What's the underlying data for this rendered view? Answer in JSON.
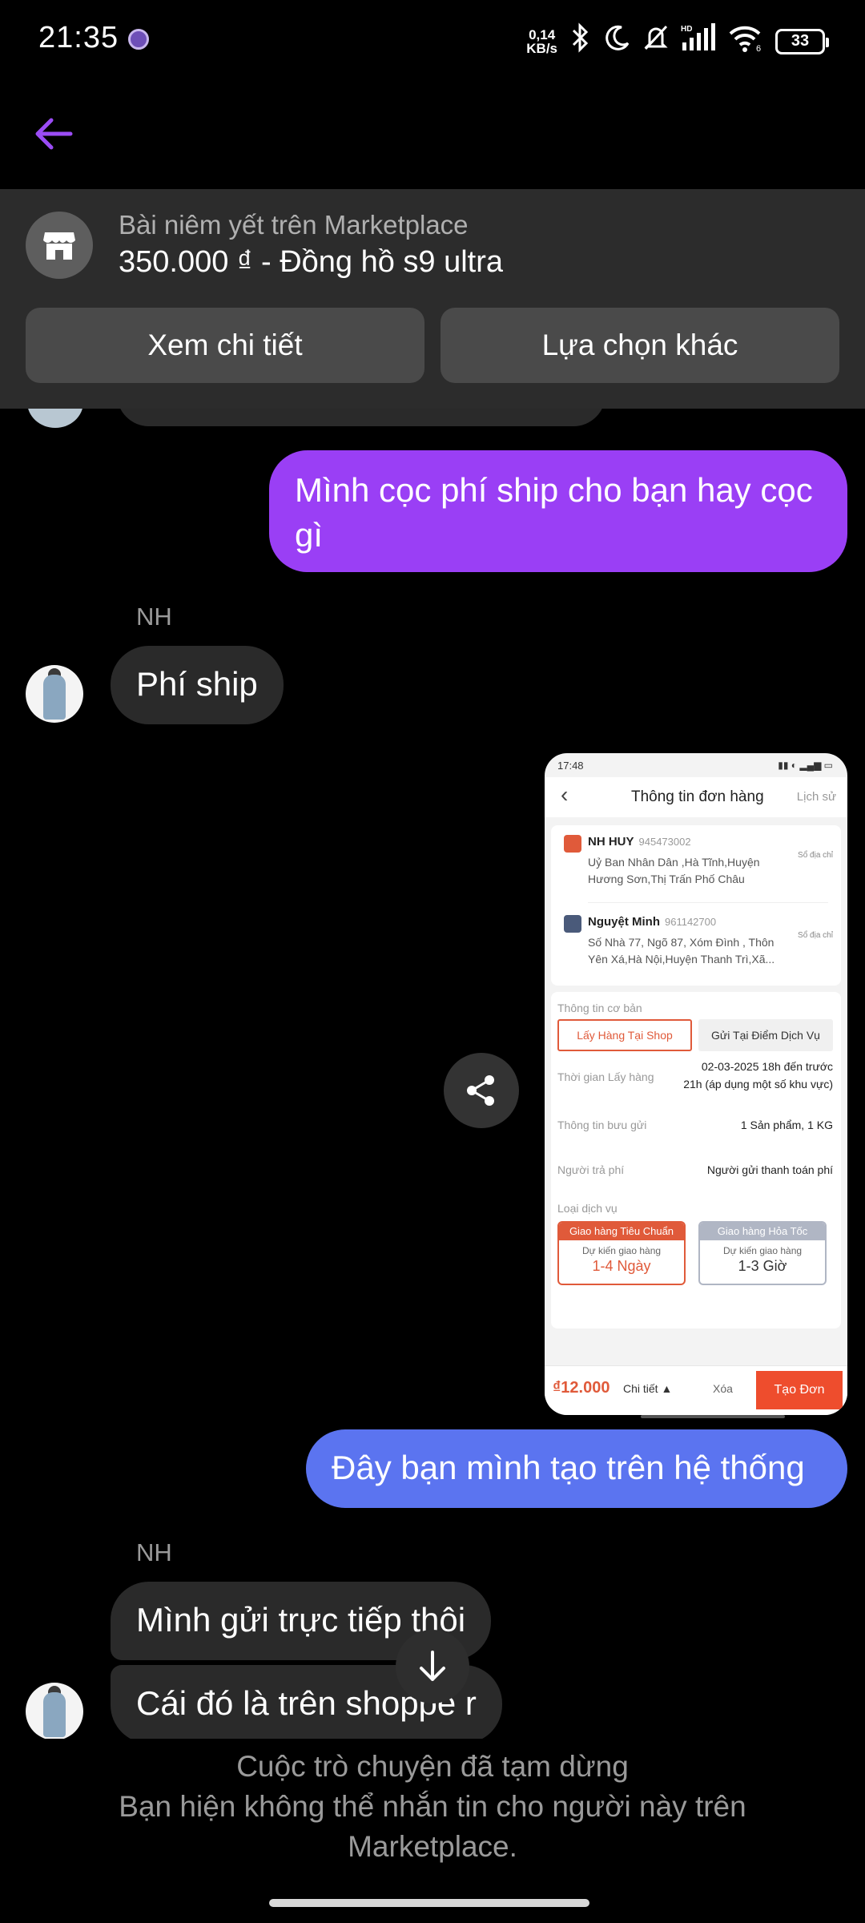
{
  "status_bar": {
    "time": "21:35",
    "net_speed": "0,14",
    "net_unit": "KB/s",
    "icons": [
      "bluetooth-icon",
      "moon-icon",
      "bell-off-icon",
      "signal-hd-icon",
      "wifi-icon"
    ],
    "wifi_badge": "6",
    "battery": "33"
  },
  "header": {
    "back_icon": "arrow-left-icon",
    "accent_color": "#9b4cf5"
  },
  "listing": {
    "icon": "storefront-icon",
    "caption": "Bài niêm yết trên Marketplace",
    "title": "350.000 ₫ - Đồng hồ s9 ultra",
    "buttons": {
      "details": "Xem chi tiết",
      "other": "Lựa chọn khác"
    }
  },
  "messages": {
    "out_1": "Mình cọc phí ship cho bạn hay cọc gì",
    "sender_1": "NH",
    "in_1": "Phí ship",
    "out_2": "Đây bạn mình tạo trên hệ thống",
    "sender_2": "NH",
    "in_2": "Mình gửi trực tiếp thôi",
    "in_3": "Cái đó là trên shoppe r"
  },
  "attachment": {
    "time": "17:48",
    "title": "Thông tin đơn hàng",
    "history": "Lịch sử",
    "sender_name": "NH HUY",
    "sender_phone": "945473002",
    "sender_addr": "Uỷ Ban Nhân Dân ,Hà Tĩnh,Huyện Hương Sơn,Thị Trấn Phố Châu",
    "receiver_name": "Nguyệt Minh",
    "receiver_phone": "961142700",
    "receiver_addr": "Số Nhà 77, Ngõ 87, Xóm Đình , Thôn Yên Xá,Hà Nội,Huyện Thanh Trì,Xã...",
    "addr_book": "Sổ địa chỉ",
    "basic_info": "Thông tin cơ bản",
    "tab_pickup": "Lấy Hàng Tại Shop",
    "tab_dropoff": "Gửi Tại Điểm Dịch Vụ",
    "pickup_time_label": "Thời gian Lấy hàng",
    "pickup_time_value": "02-03-2025 18h đến trước 21h (áp dụng một số khu vực)",
    "parcel_label": "Thông tin bưu gửi",
    "parcel_value": "1 Sản phẩm, 1 KG",
    "payer_label": "Người trả phí",
    "payer_value": "Người gửi thanh toán phí",
    "service_label": "Loại dịch vụ",
    "svc_standard": "Giao hàng Tiêu Chuẩn",
    "svc_express": "Giao hàng Hỏa Tốc",
    "svc_eta_label": "Dự kiến giao hàng",
    "svc_standard_eta": "1-4 Ngày",
    "svc_express_eta": "1-3 Giờ",
    "price": "₫12.000",
    "detail": "Chi tiết ▲",
    "delete": "Xóa",
    "create": "Tạo Đơn"
  },
  "footer": {
    "line1": "Cuộc trò chuyện đã tạm dừng",
    "line2": "Bạn hiện không thể nhắn tin cho người này trên Marketplace."
  }
}
